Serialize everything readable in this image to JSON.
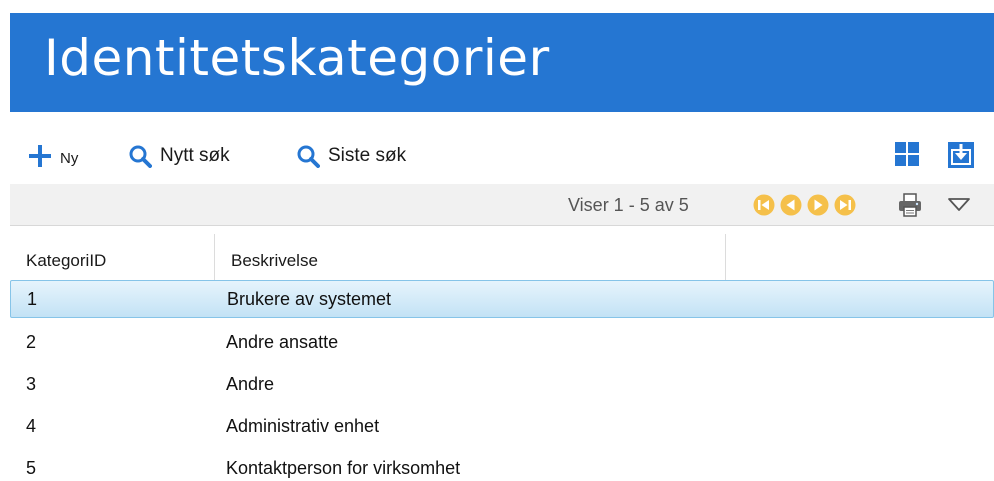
{
  "page": {
    "title": "Identitetskategorier"
  },
  "toolbar": {
    "new_label": "Ny",
    "new_search_label": "Nytt søk",
    "last_search_label": "Siste søk",
    "accent_color": "#2576d2"
  },
  "pager": {
    "info_text": "Viser 1 - 5 av 5",
    "nav_color": "#f5c04a"
  },
  "grid": {
    "columns": [
      "KategoriID",
      "Beskrivelse"
    ],
    "rows": [
      {
        "id": "1",
        "description": "Brukere av systemet"
      },
      {
        "id": "2",
        "description": "Andre ansatte"
      },
      {
        "id": "3",
        "description": "Andre"
      },
      {
        "id": "4",
        "description": "Administrativ enhet"
      },
      {
        "id": "5",
        "description": "Kontaktperson for virksomhet"
      }
    ],
    "selected_row": "1"
  }
}
